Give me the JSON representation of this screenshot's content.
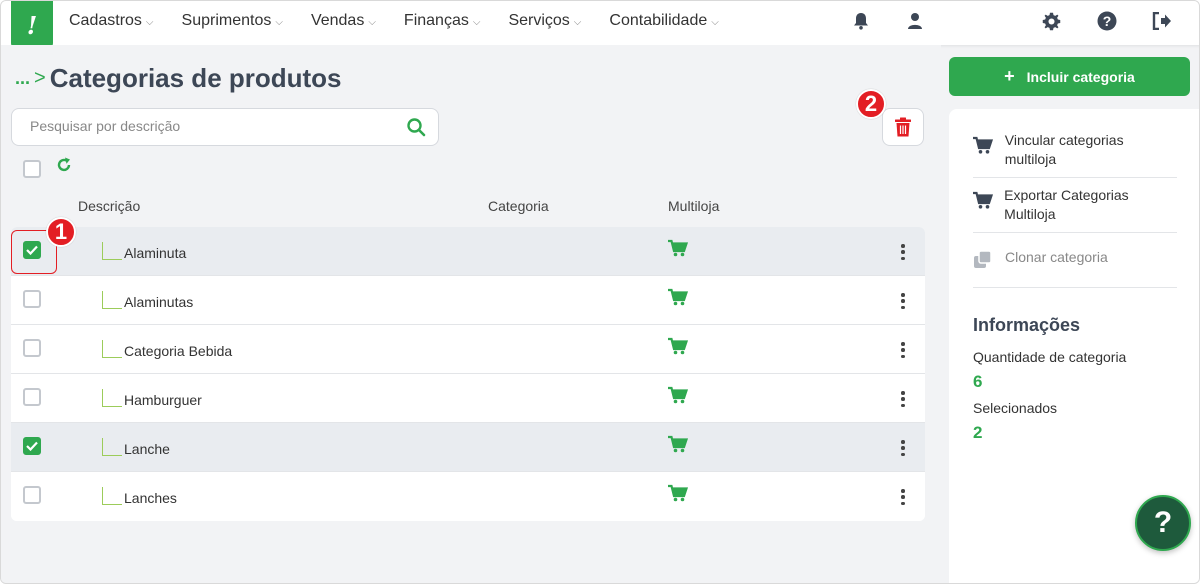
{
  "topbar": {
    "logo_text": "!",
    "menu": [
      {
        "label": "Cadastros"
      },
      {
        "label": "Suprimentos"
      },
      {
        "label": "Vendas"
      },
      {
        "label": "Finanças"
      },
      {
        "label": "Serviços"
      },
      {
        "label": "Contabilidade"
      }
    ],
    "icons": [
      "bell-icon",
      "user-icon",
      "gear-icon",
      "help-circle-icon",
      "logout-icon"
    ]
  },
  "page": {
    "breadcrumb_dots": "...",
    "breadcrumb_sep": ">",
    "title": "Categorias de produtos"
  },
  "search": {
    "placeholder": "Pesquisar por descrição"
  },
  "table": {
    "columns": {
      "descricao": "Descrição",
      "categoria": "Categoria",
      "multiloja": "Multiloja"
    },
    "rows": [
      {
        "label": "Alaminuta",
        "checked": true
      },
      {
        "label": "Alaminutas",
        "checked": false
      },
      {
        "label": "Categoria Bebida",
        "checked": false
      },
      {
        "label": "Hamburguer",
        "checked": false
      },
      {
        "label": "Lanche",
        "checked": true
      },
      {
        "label": "Lanches",
        "checked": false
      }
    ]
  },
  "callouts": {
    "one": "1",
    "two": "2"
  },
  "sidebar": {
    "add_button": "Incluir categoria",
    "add_plus": "+",
    "actions": [
      {
        "label": "Vincular categorias multiloja",
        "icon": "cart-icon"
      },
      {
        "label": "Exportar Categorias Multiloja",
        "icon": "cart-icon"
      },
      {
        "label": "Clonar categoria",
        "icon": "clone-icon"
      }
    ],
    "info_title": "Informações",
    "quantity_label": "Quantidade de categoria",
    "quantity_value": "6",
    "selected_label": "Selecionados",
    "selected_value": "2"
  },
  "help_fab": "?",
  "colors": {
    "accent": "#2fa84f",
    "danger": "#e31e24",
    "title": "#3d4756"
  }
}
